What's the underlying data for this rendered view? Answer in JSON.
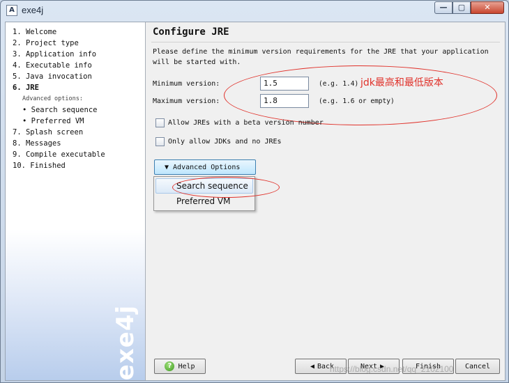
{
  "window": {
    "title": "exe4j",
    "controls": {
      "minimize": "—",
      "maximize": "▢",
      "close": "✕"
    }
  },
  "sidebar": {
    "steps": [
      {
        "label": "1. Welcome",
        "active": false
      },
      {
        "label": "2. Project type",
        "active": false
      },
      {
        "label": "3. Application info",
        "active": false
      },
      {
        "label": "4. Executable info",
        "active": false
      },
      {
        "label": "5. Java invocation",
        "active": false
      },
      {
        "label": "6. JRE",
        "active": true
      }
    ],
    "advanced_header": "Advanced options:",
    "substeps": [
      "• Search sequence",
      "• Preferred VM"
    ],
    "later_steps": [
      "7. Splash screen",
      "8. Messages",
      "9. Compile executable",
      "10. Finished"
    ],
    "brand": "exe4j"
  },
  "main": {
    "title": "Configure JRE",
    "description": "Please define the minimum version requirements for the JRE that your application will be started with.",
    "min_version": {
      "label": "Minimum version:",
      "value": "1.5",
      "hint": "(e.g. 1.4)"
    },
    "max_version": {
      "label": "Maximum version:",
      "value": "1.8",
      "hint": "(e.g. 1.6 or empty)"
    },
    "annotation": "jdk最高和最低版本",
    "checkboxes": [
      {
        "label": "Allow JREs with a beta version number",
        "checked": false
      },
      {
        "label": "Only allow JDKs and no JREs",
        "checked": false
      }
    ],
    "advanced_button": "Advanced Options",
    "dropdown_items": [
      "Search sequence",
      "Preferred VM"
    ]
  },
  "footer": {
    "help": "Help",
    "back": "Back",
    "next": "Next",
    "finish": "Finish",
    "cancel": "Cancel",
    "watermark": "https://blog.csdn.net/qq_2102100"
  },
  "colors": {
    "annotation_red": "#e0312a",
    "accent_blue": "#3c7fb1"
  }
}
